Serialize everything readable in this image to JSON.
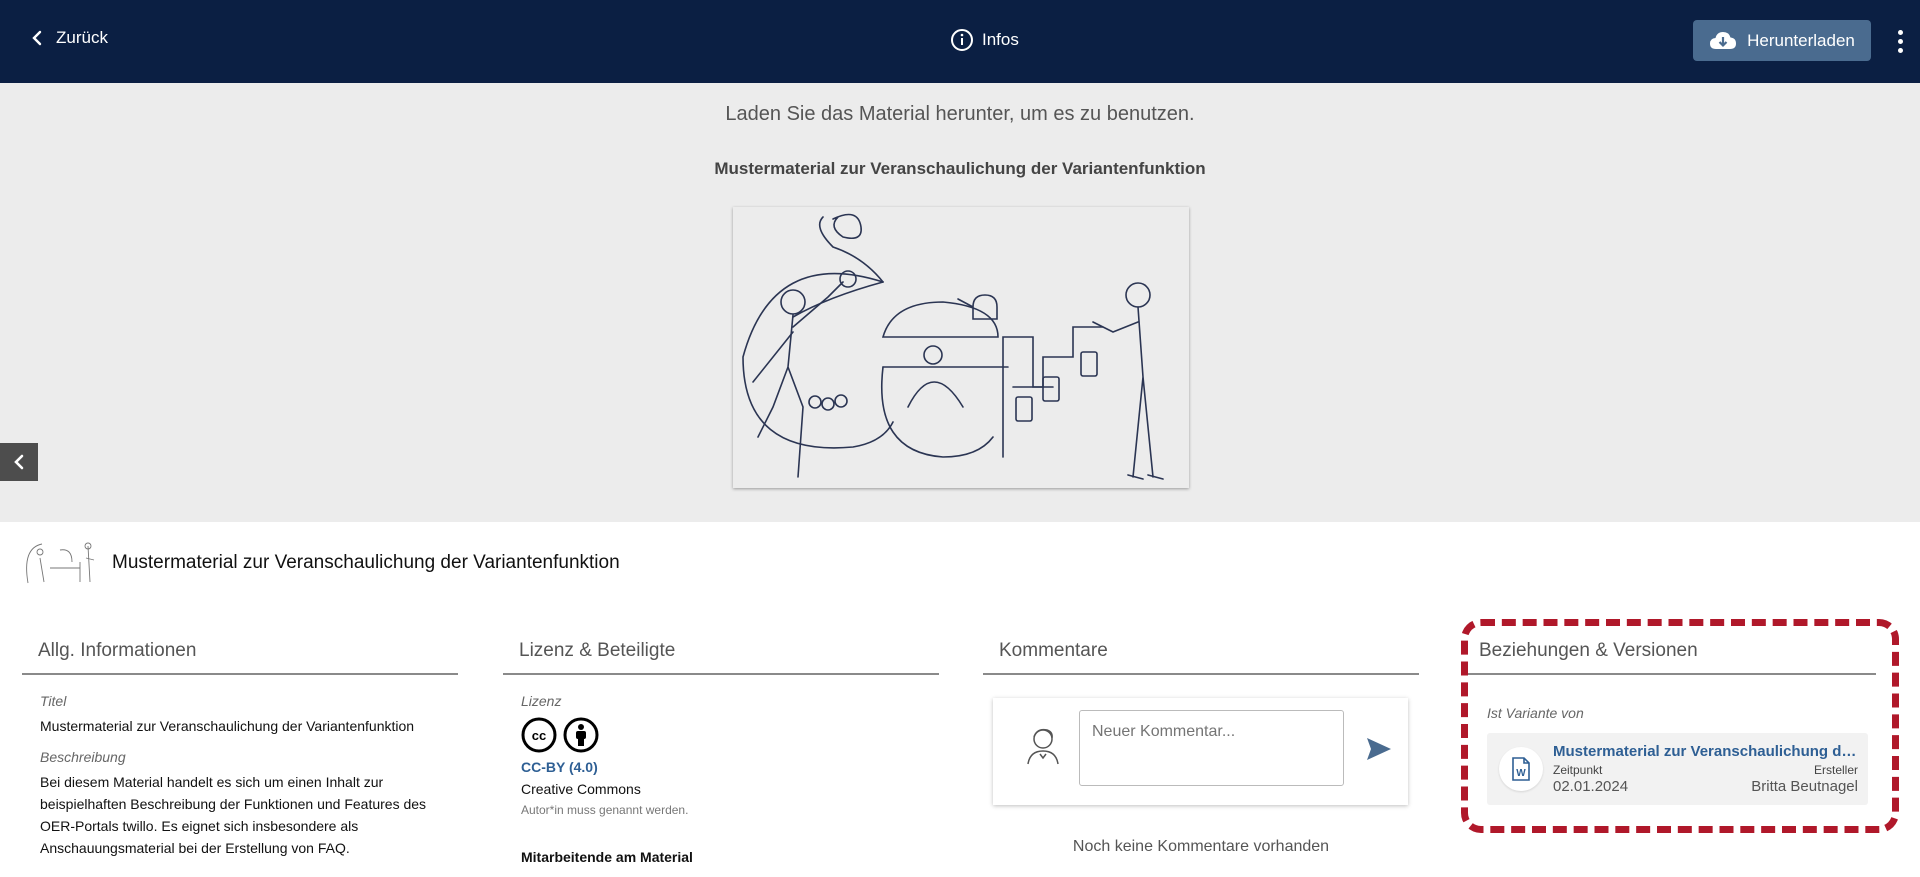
{
  "header": {
    "back_label": "Zurück",
    "info_label": "Infos",
    "download_label": "Herunterladen"
  },
  "preview": {
    "hint": "Laden Sie das Material herunter, um es zu benutzen.",
    "title": "Mustermaterial zur Veranschaulichung der Variantenfunktion"
  },
  "material": {
    "title": "Mustermaterial zur Veranschaulichung der Variantenfunktion"
  },
  "general": {
    "heading": "Allg. Informationen",
    "title_label": "Titel",
    "title_value": "Mustermaterial zur Veranschaulichung der Variantenfunktion",
    "description_label": "Beschreibung",
    "description_value": "Bei diesem Material handelt es sich um einen Inhalt zur beispielhaften Beschreibung der Funktionen und Features des OER-Portals twillo. Es eignet sich insbesondere als Anschauungsmaterial bei der Erstellung von FAQ."
  },
  "license": {
    "heading": "Lizenz & Beteiligte",
    "label": "Lizenz",
    "link": "CC-BY (4.0)",
    "name": "Creative Commons",
    "note": "Autor*in muss genannt werden.",
    "contributors_heading": "Mitarbeitende am Material"
  },
  "comments": {
    "heading": "Kommentare",
    "placeholder": "Neuer Kommentar...",
    "empty": "Noch keine Kommentare vorhanden"
  },
  "relations": {
    "heading": "Beziehungen & Versionen",
    "variant_label": "Ist Variante von",
    "card": {
      "title": "Mustermaterial zur Veranschaulichung der Variantenfunktion",
      "time_label": "Zeitpunkt",
      "creator_label": "Ersteller",
      "time": "02.01.2024",
      "creator": "Britta Beutnagel"
    }
  },
  "colors": {
    "header_bg": "#0b1f43",
    "download_bg": "#4a6b8f",
    "link": "#2e5f94",
    "highlight": "#b0182a"
  }
}
